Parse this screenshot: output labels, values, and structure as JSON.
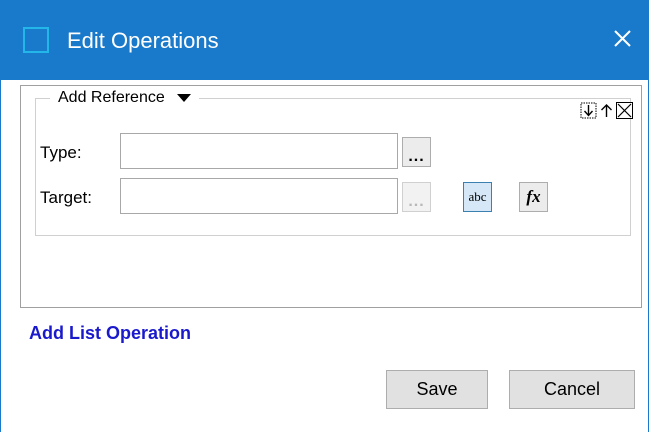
{
  "window": {
    "title": "Edit Operations",
    "close_glyph": "✕"
  },
  "operation": {
    "legend": "Add Reference",
    "type_label": "Type:",
    "type_value": "",
    "target_label": "Target:",
    "target_value": "",
    "browse_glyph": "...",
    "abc_label": "abc",
    "fx_label": "fx"
  },
  "footer": {
    "add_list_link": "Add List Operation",
    "save_label": "Save",
    "cancel_label": "Cancel"
  },
  "colors": {
    "title_bar": "#1979ca",
    "link": "#1a1acc",
    "selected_button": "#d6e8f7"
  }
}
